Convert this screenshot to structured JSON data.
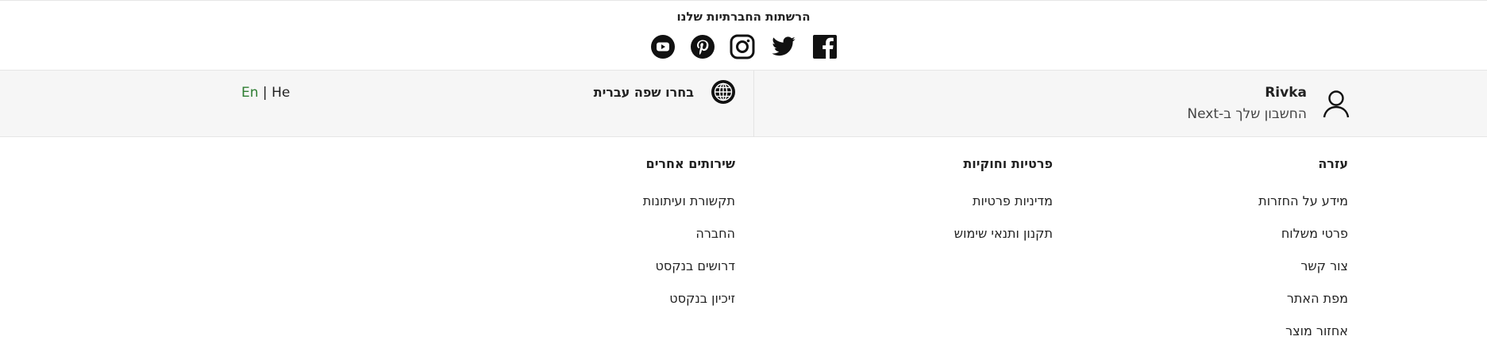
{
  "social": {
    "title": "הרשתות החברתיות שלנו",
    "icons": [
      "youtube-icon",
      "pinterest-icon",
      "instagram-icon",
      "twitter-icon",
      "facebook-icon"
    ]
  },
  "account": {
    "name": "Rivka",
    "subtitle": "החשבון שלך ב-Next"
  },
  "language": {
    "label": "בחרו שפה עברית",
    "en": "En",
    "separator": "|",
    "he": "He",
    "active_color": "#2e7d32"
  },
  "footer": {
    "columns": [
      {
        "heading": "עזרה",
        "items": [
          "מידע על החזרות",
          "פרטי משלוח",
          "צור קשר",
          "מפת האתר",
          "אחזור מוצר"
        ]
      },
      {
        "heading": "פרטיות וחוקיות",
        "items": [
          "מדיניות פרטיות",
          "תקנון ותנאי שימוש"
        ]
      },
      {
        "heading": "שירותים אחרים",
        "items": [
          "תקשורת ועיתונות",
          "החברה",
          "דרושים בנקסט",
          "זיכיון בנקסט"
        ]
      }
    ]
  }
}
